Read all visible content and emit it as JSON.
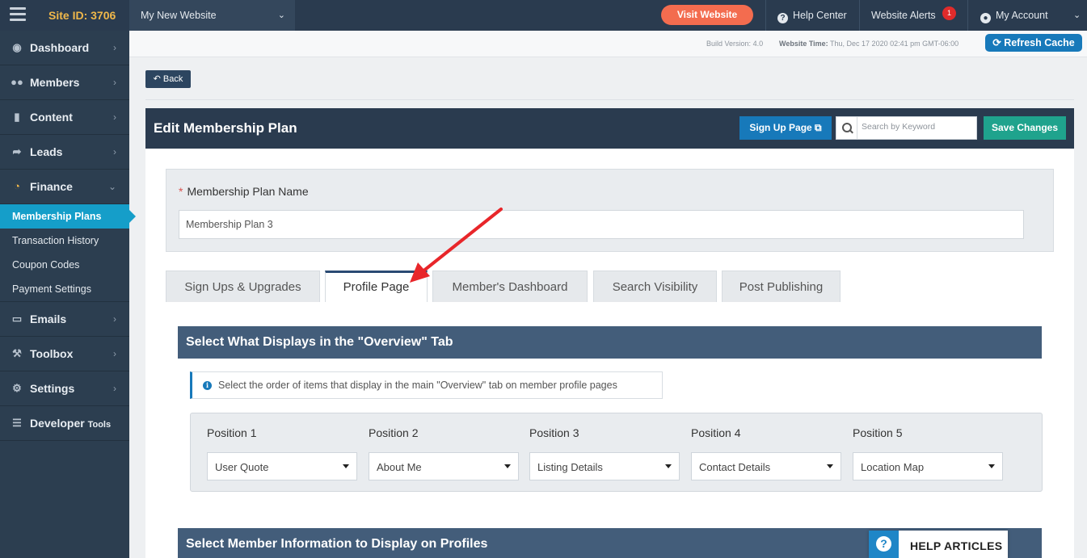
{
  "topbar": {
    "site_id": "Site ID: 3706",
    "site_select": "My New Website",
    "visit_website": "Visit Website",
    "help_center": "Help Center",
    "website_alerts": "Website Alerts",
    "alerts_count": "1",
    "my_account": "My Account"
  },
  "sidebar": {
    "items": [
      {
        "label": "Dashboard"
      },
      {
        "label": "Members"
      },
      {
        "label": "Content"
      },
      {
        "label": "Leads"
      },
      {
        "label": "Finance"
      },
      {
        "label": "Emails"
      },
      {
        "label": "Toolbox"
      },
      {
        "label": "Settings"
      },
      {
        "label": "Developer",
        "suffix": "Tools"
      }
    ],
    "finance_sub": [
      {
        "label": "Membership Plans",
        "active": true
      },
      {
        "label": "Transaction History"
      },
      {
        "label": "Coupon Codes"
      },
      {
        "label": "Payment Settings"
      }
    ]
  },
  "buildbar": {
    "build_label": "Build Version:",
    "build_value": "4.0",
    "time_label": "Website Time:",
    "time_value": "Thu, Dec 17 2020 02:41 pm GMT-06:00",
    "refresh_cache": "Refresh Cache"
  },
  "main": {
    "back": "Back",
    "panel_title": "Edit Membership Plan",
    "signup_page": "Sign Up Page",
    "search_placeholder": "Search by Keyword",
    "save_changes": "Save Changes",
    "plan_name_label": "Membership Plan Name",
    "plan_name_required": "*",
    "plan_name_value": "Membership Plan 3",
    "tabs": [
      {
        "label": "Sign Ups & Upgrades"
      },
      {
        "label": "Profile Page",
        "active": true
      },
      {
        "label": "Member's Dashboard"
      },
      {
        "label": "Search Visibility"
      },
      {
        "label": "Post Publishing"
      }
    ],
    "section1_title": "Select What Displays in the \"Overview\" Tab",
    "info_note": "Select the order of items that display in the main \"Overview\" tab on member profile pages",
    "positions": [
      {
        "label": "Position 1",
        "value": "User Quote"
      },
      {
        "label": "Position 2",
        "value": "About Me"
      },
      {
        "label": "Position 3",
        "value": "Listing Details"
      },
      {
        "label": "Position 4",
        "value": "Contact Details"
      },
      {
        "label": "Position 5",
        "value": "Location Map"
      }
    ],
    "section2_title": "Select Member Information to Display on Profiles"
  },
  "help_articles": "HELP ARTICLES",
  "colors": {
    "topbar": "#2a3b4f",
    "visit_btn": "#f36c4f",
    "active_subnav": "#159ec9",
    "primary_btn": "#1779ba",
    "save_btn": "#1fa38d",
    "section_head": "#435d7a",
    "annotation_arrow": "#e8262a"
  },
  "icons": {
    "dashboard": "tachometer-icon",
    "members": "users-icon",
    "content": "folder-icon",
    "leads": "share-icon",
    "finance": "pie-chart-icon",
    "emails": "inbox-icon",
    "toolbox": "wrench-icon",
    "settings": "gear-icon",
    "developer": "sliders-icon"
  }
}
